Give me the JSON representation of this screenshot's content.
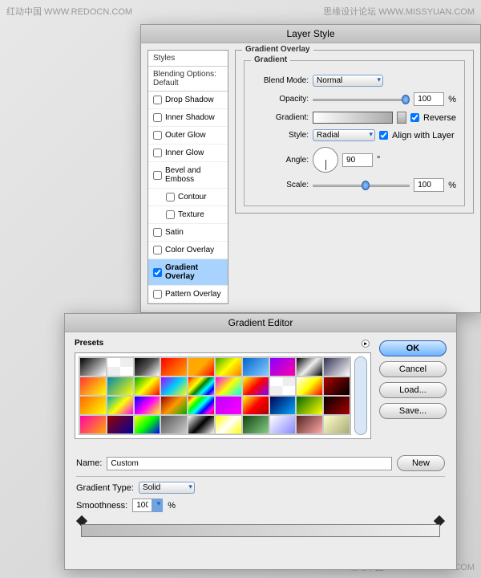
{
  "watermarks": {
    "top_left": "红动中国 WWW.REDOCN.COM",
    "top_right": "思缘设计论坛 WWW.MISSYUAN.COM",
    "bottom_right": "红动中国 WWW.REDOCN.COM"
  },
  "layerStyle": {
    "title": "Layer Style",
    "stylesHeader": "Styles",
    "blendingHeader": "Blending Options: Default",
    "items": [
      {
        "label": "Drop Shadow",
        "checked": false,
        "indent": false
      },
      {
        "label": "Inner Shadow",
        "checked": false,
        "indent": false
      },
      {
        "label": "Outer Glow",
        "checked": false,
        "indent": false
      },
      {
        "label": "Inner Glow",
        "checked": false,
        "indent": false
      },
      {
        "label": "Bevel and Emboss",
        "checked": false,
        "indent": false
      },
      {
        "label": "Contour",
        "checked": false,
        "indent": true
      },
      {
        "label": "Texture",
        "checked": false,
        "indent": true
      },
      {
        "label": "Satin",
        "checked": false,
        "indent": false
      },
      {
        "label": "Color Overlay",
        "checked": false,
        "indent": false
      },
      {
        "label": "Gradient Overlay",
        "checked": true,
        "indent": false,
        "selected": true
      },
      {
        "label": "Pattern Overlay",
        "checked": false,
        "indent": false
      }
    ],
    "panelTitle": "Gradient Overlay",
    "subTitle": "Gradient",
    "labels": {
      "blendMode": "Blend Mode:",
      "opacity": "Opacity:",
      "gradient": "Gradient:",
      "style": "Style:",
      "angle": "Angle:",
      "scale": "Scale:",
      "reverse": "Reverse",
      "align": "Align with Layer"
    },
    "values": {
      "blendMode": "Normal",
      "opacity": "100",
      "style": "Radial",
      "angle": "90",
      "scale": "100",
      "reverse": true,
      "align": true
    }
  },
  "gradEditor": {
    "title": "Gradient Editor",
    "presetsLabel": "Presets",
    "buttons": {
      "ok": "OK",
      "cancel": "Cancel",
      "load": "Load...",
      "save": "Save...",
      "new": "New"
    },
    "nameLabel": "Name:",
    "nameValue": "Custom",
    "typeLabel": "Gradient Type:",
    "typeValue": "Solid",
    "smoothLabel": "Smoothness:",
    "smoothValue": "100",
    "smoothUnit": "%",
    "presets": [
      "linear-gradient(135deg,#000,#fff)",
      "repeating-conic-gradient(#eee 0 25%,#fff 0 50%)",
      "linear-gradient(135deg,#000,#555,#fff)",
      "linear-gradient(135deg,red,orange)",
      "linear-gradient(135deg,orange,#fa0,red)",
      "linear-gradient(135deg,#4a0,#ff0,#f70)",
      "linear-gradient(135deg,#06c,#8cf)",
      "linear-gradient(135deg,#80f,#f0a)",
      "linear-gradient(135deg,#000,#eee,#000)",
      "linear-gradient(135deg,#335,#fff)",
      "linear-gradient(135deg,#f33,#ff0)",
      "linear-gradient(135deg,#08a,#ff0)",
      "linear-gradient(135deg,#0a0,#ff0,#f00)",
      "linear-gradient(135deg,#a0f,#0cf,#ff0)",
      "linear-gradient(135deg,red,orange,yellow,green,cyan,blue,violet)",
      "linear-gradient(135deg,#f0f,#ff0,#0ff)",
      "linear-gradient(135deg,#ff0,red,#80f)",
      "repeating-conic-gradient(#eee 0 25%,#fff 0 50%)",
      "linear-gradient(135deg,#fff,#ff0,#f00)",
      "linear-gradient(135deg,#a00,#000)",
      "linear-gradient(135deg,#f60,#ff0)",
      "linear-gradient(135deg,#0aa,#ff0,#f0f)",
      "linear-gradient(135deg,#00f,#f0f,#ff0)",
      "linear-gradient(135deg,#900,#f90,#0a0)",
      "linear-gradient(135deg,red,yellow,lime,cyan,blue,magenta,red)",
      "linear-gradient(135deg,#b0f,#f0f)",
      "linear-gradient(135deg,#ff0,#f00,#a00)",
      "linear-gradient(135deg,#005,#0af)",
      "linear-gradient(135deg,#060,#ff0)",
      "linear-gradient(135deg,#000,#a00)",
      "linear-gradient(135deg,#f0a,#fa0)",
      "linear-gradient(135deg,#900,#009)",
      "linear-gradient(135deg,#ff0,#0f0,#00f)",
      "linear-gradient(135deg,#555,#ccc)",
      "linear-gradient(135deg,#fff,#000,#fff)",
      "linear-gradient(135deg,#ff0,#fff,#ff0)",
      "linear-gradient(135deg,#141,#8c8)",
      "linear-gradient(135deg,#fff,#88f)",
      "linear-gradient(135deg,#522,#faa)",
      "linear-gradient(135deg,#ffc,#aa7)"
    ]
  }
}
